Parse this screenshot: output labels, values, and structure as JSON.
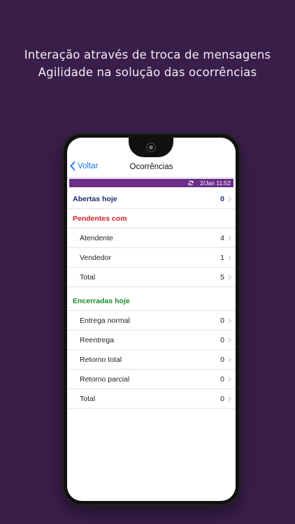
{
  "headline": {
    "line1": "Interação através de troca de mensagens",
    "line2": "Agilidade na solução das ocorrências"
  },
  "nav": {
    "back_label": "Voltar",
    "title": "Ocorrências"
  },
  "status": {
    "timestamp": "2/Jan 11:52",
    "accent": "#6b2f8a"
  },
  "abertas": {
    "label": "Abertas hoje",
    "count": "0"
  },
  "pendentes": {
    "label": "Pendentes com",
    "items": [
      {
        "label": "Atendente",
        "count": "4"
      },
      {
        "label": "Vendedor",
        "count": "1"
      },
      {
        "label": "Total",
        "count": "5"
      }
    ]
  },
  "encerradas": {
    "label": "Encerradas hoje",
    "items": [
      {
        "label": "Entrega normal",
        "count": "0"
      },
      {
        "label": "Reentrega",
        "count": "0"
      },
      {
        "label": "Retorno total",
        "count": "0"
      },
      {
        "label": "Retorno parcial",
        "count": "0"
      },
      {
        "label": "Total",
        "count": "0"
      }
    ]
  },
  "icons": {
    "back": "chevron-left-icon",
    "refresh": "refresh-icon",
    "row": "chevron-right-icon",
    "camera": "camera-icon"
  }
}
